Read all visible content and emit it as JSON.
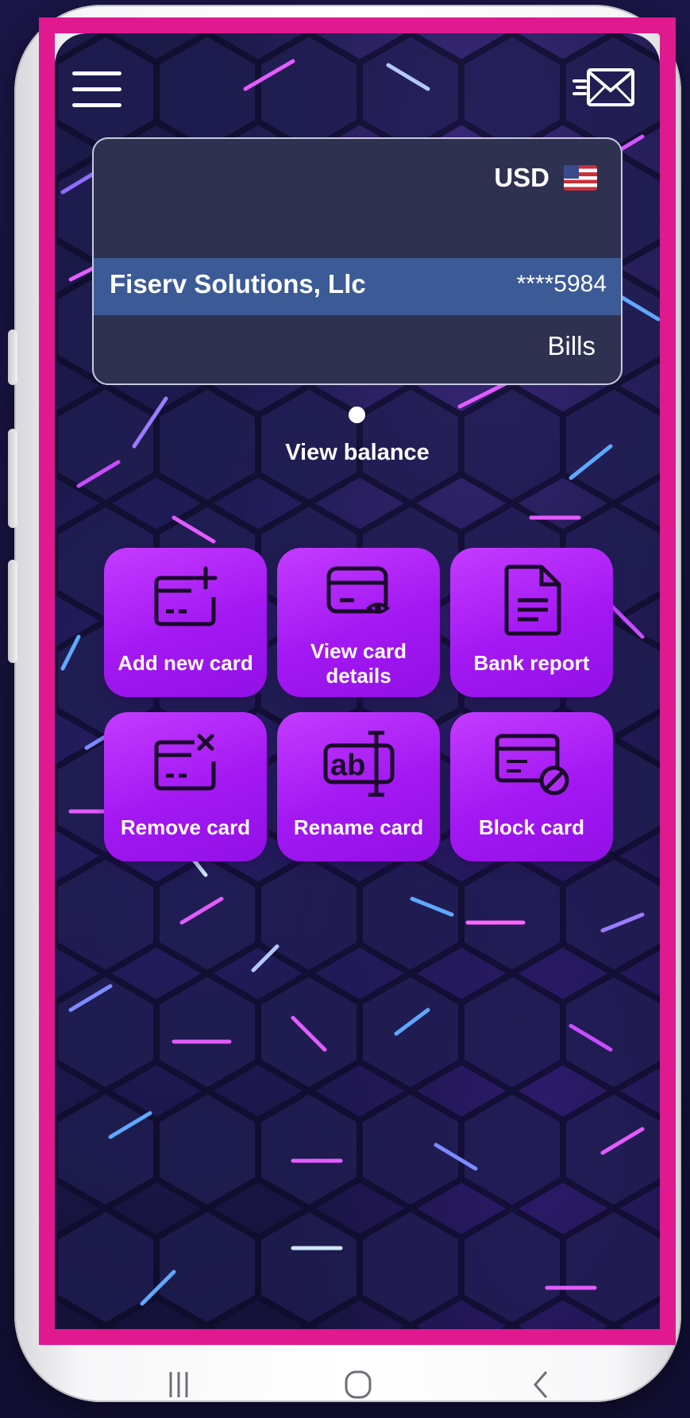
{
  "header": {
    "menu_icon": "hamburger-menu-icon",
    "mail_icon": "send-mail-icon"
  },
  "account_card": {
    "currency": "USD",
    "flag_icon": "us-flag-icon",
    "holder_name": "Fiserv Solutions, Llc",
    "masked_number": "****5984",
    "card_type": "Bills"
  },
  "pager": {
    "active_index": 1,
    "total": 1
  },
  "view_balance_label": "View balance",
  "actions": [
    {
      "label": "Add new card",
      "icon": "add-card-icon"
    },
    {
      "label_line1": "View card",
      "label_line2": "details",
      "icon": "view-card-icon"
    },
    {
      "label": "Bank report",
      "icon": "document-icon"
    },
    {
      "label": "Remove card",
      "icon": "remove-card-icon"
    },
    {
      "label": "Rename card",
      "icon": "rename-text-icon"
    },
    {
      "label": "Block card",
      "icon": "block-card-icon"
    }
  ],
  "nav_bar": {
    "recents_icon": "recents-icon",
    "home_icon": "home-icon",
    "back_icon": "back-icon"
  },
  "colors": {
    "highlight": "#e0198f",
    "action_tile": "#a318f2",
    "card_bg": "#2e3150",
    "holder_row": "#3b5a96"
  }
}
